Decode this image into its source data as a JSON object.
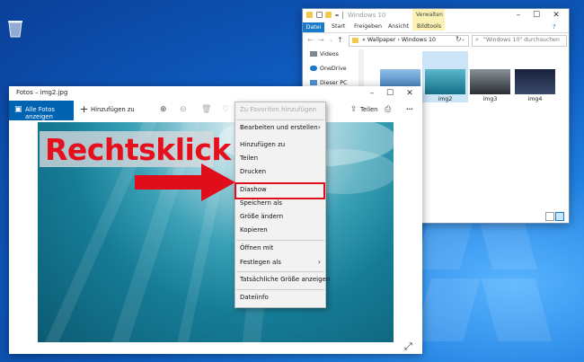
{
  "explorer": {
    "title": "Windows 10",
    "manage_tab": "Verwalten",
    "window_controls": [
      "–",
      "☐",
      "✕"
    ],
    "ribbon_tabs": [
      "Datei",
      "Start",
      "Freigeben",
      "Ansicht",
      "Bildtools"
    ],
    "nav": {
      "back": "←",
      "forward": "→",
      "dropdown": "⌄",
      "up": "↑"
    },
    "address": {
      "path": "«  Wallpaper  ›  Windows 10",
      "chevron": "⌄"
    },
    "refresh": "↻",
    "search_placeholder": "\"Windows 10\" durchsuchen",
    "sidebar": [
      "Videos",
      "OneDrive",
      "Dieser PC"
    ],
    "files": [
      {
        "name": "",
        "color_top": "#8fbde6",
        "color_bottom": "#2c6fae"
      },
      {
        "name": "img2",
        "color_top": "#5bb7cc",
        "color_bottom": "#136f86"
      },
      {
        "name": "img3",
        "color_top": "#8a8f97",
        "color_bottom": "#2a2e34"
      },
      {
        "name": "img4",
        "color_top": "#18223a",
        "color_bottom": "#3c4a6d"
      }
    ]
  },
  "photos": {
    "title": "Fotos – img2.jpg",
    "window_controls": [
      "–",
      "☐",
      "✕"
    ],
    "all_photos": "Alle Fotos anzeigen",
    "add_to": "Hinzufügen zu",
    "share": "Teilen",
    "more": "···",
    "overlay_text": "Rechtsklick"
  },
  "context_menu": {
    "items": [
      {
        "label": "Zu Favoriten hinzufügen",
        "disabled": true
      },
      {
        "label": "Bearbeiten und erstellen",
        "submenu": true
      },
      {
        "label": "Hinzufügen zu"
      },
      {
        "label": "Teilen"
      },
      {
        "label": "Drucken"
      },
      {
        "label": "Diashow"
      },
      {
        "label": "Speichern als"
      },
      {
        "label": "Größe ändern"
      },
      {
        "label": "Kopieren"
      },
      {
        "label": "Öffnen mit"
      },
      {
        "label": "Festlegen als",
        "submenu": true
      },
      {
        "label": "Tatsächliche Größe anzeigen"
      },
      {
        "label": "Dateiinfo"
      }
    ],
    "submenu_glyph": "›"
  },
  "colors": {
    "accent": "#0063b1",
    "highlight": "#e00d1a",
    "arrow": "#e00d1a",
    "overlay_text": "#e60f1c"
  }
}
